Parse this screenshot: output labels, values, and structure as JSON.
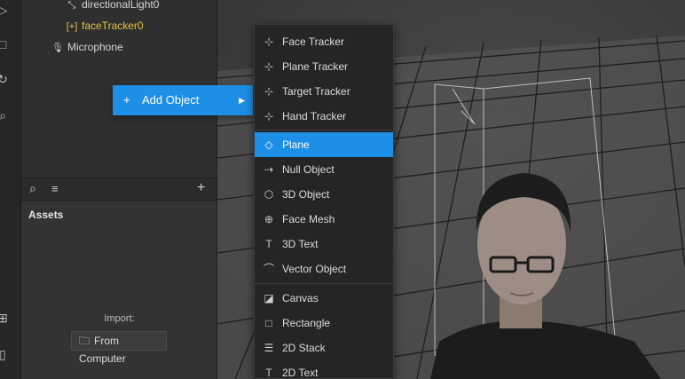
{
  "toolbar": {
    "icons": [
      "play-icon",
      "stop-icon",
      "refresh-icon",
      "search-icon",
      "add-icon",
      "device-icon"
    ]
  },
  "scene": {
    "items": [
      {
        "label": "directionalLight0",
        "icon": "light-icon"
      },
      {
        "label": "faceTracker0",
        "icon": "face-tracker-icon",
        "selected": true
      },
      {
        "label": "Microphone",
        "icon": "microphone-icon"
      }
    ]
  },
  "assets": {
    "title": "Assets",
    "import_label": "Import:",
    "from_computer": "From Computer"
  },
  "context_menu": {
    "add_object": "Add Object"
  },
  "submenu": {
    "items": [
      {
        "label": "Face Tracker",
        "icon": "tracker-icon"
      },
      {
        "label": "Plane Tracker",
        "icon": "tracker-icon"
      },
      {
        "label": "Target Tracker",
        "icon": "tracker-icon"
      },
      {
        "label": "Hand Tracker",
        "icon": "tracker-icon"
      },
      {
        "label": "Plane",
        "icon": "plane-icon",
        "active": true
      },
      {
        "label": "Null Object",
        "icon": "null-object-icon"
      },
      {
        "label": "3D Object",
        "icon": "cube-icon"
      },
      {
        "label": "Face Mesh",
        "icon": "face-mesh-icon"
      },
      {
        "label": "3D Text",
        "icon": "text-icon"
      },
      {
        "label": "Vector Object",
        "icon": "vector-icon"
      },
      {
        "label": "Canvas",
        "icon": "canvas-icon"
      },
      {
        "label": "Rectangle",
        "icon": "rectangle-icon"
      },
      {
        "label": "2D Stack",
        "icon": "stack-icon"
      },
      {
        "label": "2D Text",
        "icon": "text-icon"
      }
    ]
  },
  "colors": {
    "accent": "#1e8fe6",
    "selected_text": "#e6c44a"
  }
}
